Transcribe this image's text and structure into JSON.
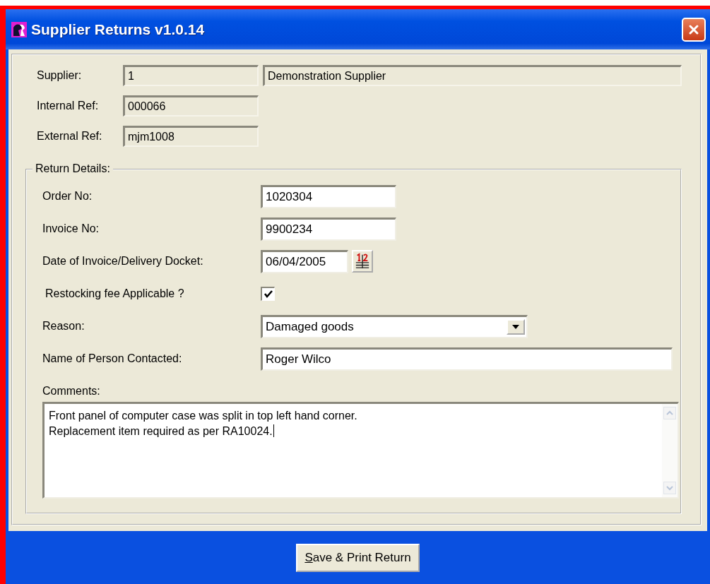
{
  "window": {
    "title": "Supplier Returns v1.0.14"
  },
  "header_fields": [
    {
      "label": "Supplier:",
      "values": [
        "1",
        "Demonstration Supplier"
      ]
    },
    {
      "label": "Internal Ref:",
      "values": [
        "000066"
      ]
    },
    {
      "label": "External Ref:",
      "values": [
        "mjm1008"
      ]
    }
  ],
  "return_details": {
    "legend": "Return Details:",
    "rows": [
      {
        "kind": "text",
        "label": "Order No:",
        "value": "1020304"
      },
      {
        "kind": "text",
        "label": "Invoice No:",
        "value": "9900234"
      },
      {
        "kind": "date",
        "label": "Date of Invoice/Delivery Docket:",
        "value": "06/04/2005"
      },
      {
        "kind": "checkbox",
        "label": "Restocking fee Applicable ?",
        "checked": true
      },
      {
        "kind": "dropdown",
        "label": "Reason:",
        "value": "Damaged goods"
      },
      {
        "kind": "wide",
        "label": "Name of Person Contacted:",
        "value": "Roger Wilco"
      }
    ],
    "comments": {
      "label": "Comments:",
      "lines": [
        "Front panel of computer case was split in top left hand corner.",
        "Replacement item required as per RA10024."
      ]
    }
  },
  "save_button": {
    "mnemonic": "S",
    "label_rest": "ave & Print Return"
  }
}
